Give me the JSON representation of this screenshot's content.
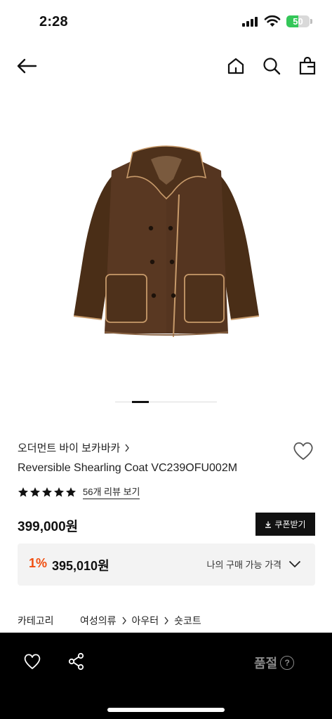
{
  "status_bar": {
    "time": "2:28",
    "battery": "50",
    "battery_level": 0.5
  },
  "nav": {
    "back_icon": "arrow-left-icon",
    "home_icon": "home-icon",
    "search_icon": "search-icon",
    "cart_icon": "shopping-bag-icon"
  },
  "product": {
    "image_alt_icon": "brown-shearling-coat",
    "pager": {
      "current": 2,
      "total": 6
    },
    "brand": "오더먼트 바이 보카바카",
    "name": "Reversible Shearling Coat VC239OFU002M",
    "rating_stars": 5,
    "review_link": "56개 리뷰 보기",
    "price": "399,000원",
    "coupon_button": "쿠폰받기",
    "member_discount_rate": "1%",
    "member_price": "395,010원",
    "my_price_label": "나의 구매 가능 가격"
  },
  "category": {
    "label": "카테고리",
    "path": [
      "여성의류",
      "아우터",
      "숏코트"
    ]
  },
  "bottom_bar": {
    "sold_out": "품절",
    "help_icon": "?",
    "like_icon": "heart-icon",
    "share_icon": "share-icon"
  },
  "colors": {
    "accent": "#f04e0f",
    "bottom_bar": "#000000",
    "coupon_button": "#111111",
    "member_box": "#f3f3f3",
    "battery": "#34c759"
  }
}
